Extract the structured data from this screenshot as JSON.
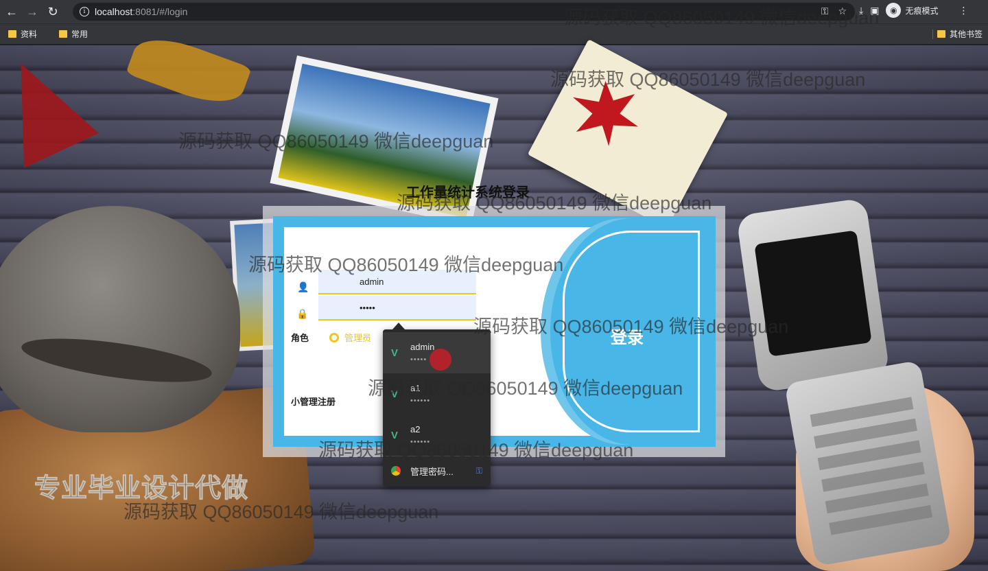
{
  "browser": {
    "url_host": "localhost",
    "url_rest": ":8081/#/login",
    "incognito_label": "无痕模式",
    "icons": [
      "back-icon",
      "forward-icon",
      "reload-icon",
      "info-icon",
      "key-icon",
      "star-icon",
      "download-icon",
      "sidebar-icon",
      "menu-icon"
    ]
  },
  "bookmarks": {
    "items": [
      "资料",
      "常用"
    ],
    "other": "其他书签"
  },
  "login": {
    "title": "工作量统计系统登录",
    "username": "admin",
    "password_mask": "•••••",
    "role_label": "角色",
    "role_option": "管理员",
    "register_link": "小管理注册",
    "login_button": "登录"
  },
  "password_dropdown": {
    "items": [
      {
        "user": "admin",
        "mask": "•••••"
      },
      {
        "user": "a1",
        "mask": "••••••"
      },
      {
        "user": "a2",
        "mask": "••••••"
      }
    ],
    "manage_label": "管理密码..."
  },
  "decor": {
    "promo_text": "专业毕业设计代做"
  },
  "watermark": "源码获取 QQ86050149 微信deepguan",
  "colors": {
    "accent_blue": "#48b6e6",
    "accent_yellow": "#f3c419",
    "chrome_bg": "#35363a"
  }
}
